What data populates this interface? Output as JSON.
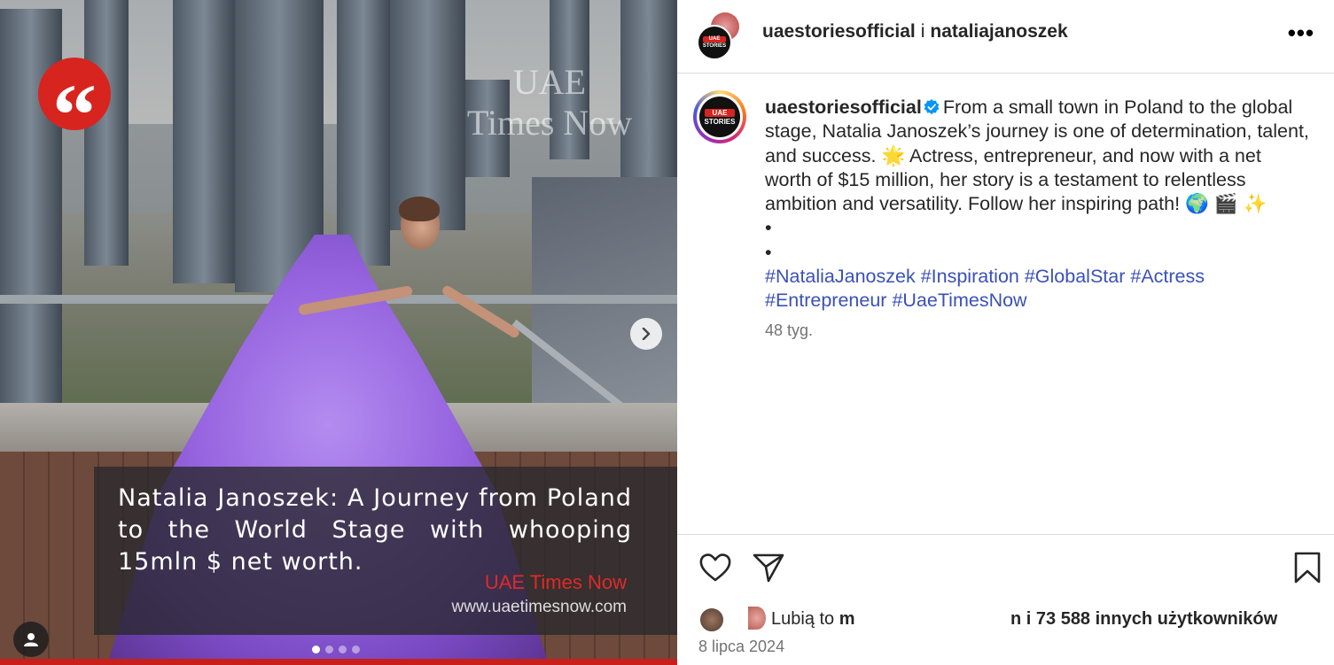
{
  "media": {
    "watermark_line1": "UAE",
    "watermark_line2": "Times Now",
    "quote_glyph": "“",
    "caption": "Natalia Janoszek: A Journey from Poland to the World Stage with whooping 15mln $ net worth.",
    "brand": "UAE Times Now",
    "url": "www.uaetimesnow.com",
    "slide_count": 4,
    "active_slide": 0
  },
  "header": {
    "account_1": "uaestoriesofficial",
    "separator": "i",
    "account_2": "nataliajanoszek",
    "more_label": "•••"
  },
  "logo": {
    "line1": "UAE",
    "line2": "STORIES"
  },
  "post": {
    "author": "uaestoriesofficial",
    "verified": true,
    "text": "From a small town in Poland to the global stage, Natalia Janoszek’s journey is one of determination, talent, and success. 🌟 Actress, entrepreneur, and now with a net worth of $15 million, her story is a testament to relentless ambition and versatility. Follow her inspiring path! 🌍 🎬 ✨",
    "bullet_1": "•",
    "bullet_2": "•",
    "hashtags": [
      "#NataliaJanoszek",
      "#Inspiration",
      "#GlobalStar",
      "#Actress",
      "#Entrepreneur",
      "#UaeTimesNow"
    ],
    "time_ago": "48 tyg."
  },
  "likes": {
    "prefix": "Lubią to",
    "name_start": "m",
    "suffix": "n i 73 588 innych użytkowników"
  },
  "date": "8 lipca 2024",
  "icons": {
    "like": "heart-icon",
    "share": "send-icon",
    "save": "bookmark-icon",
    "next": "chevron-right-icon",
    "tag": "user-icon"
  },
  "colors": {
    "hashtag": "#3a51b8",
    "brand_red": "#d8241f",
    "verified": "#0095f6",
    "muted": "#737373"
  }
}
